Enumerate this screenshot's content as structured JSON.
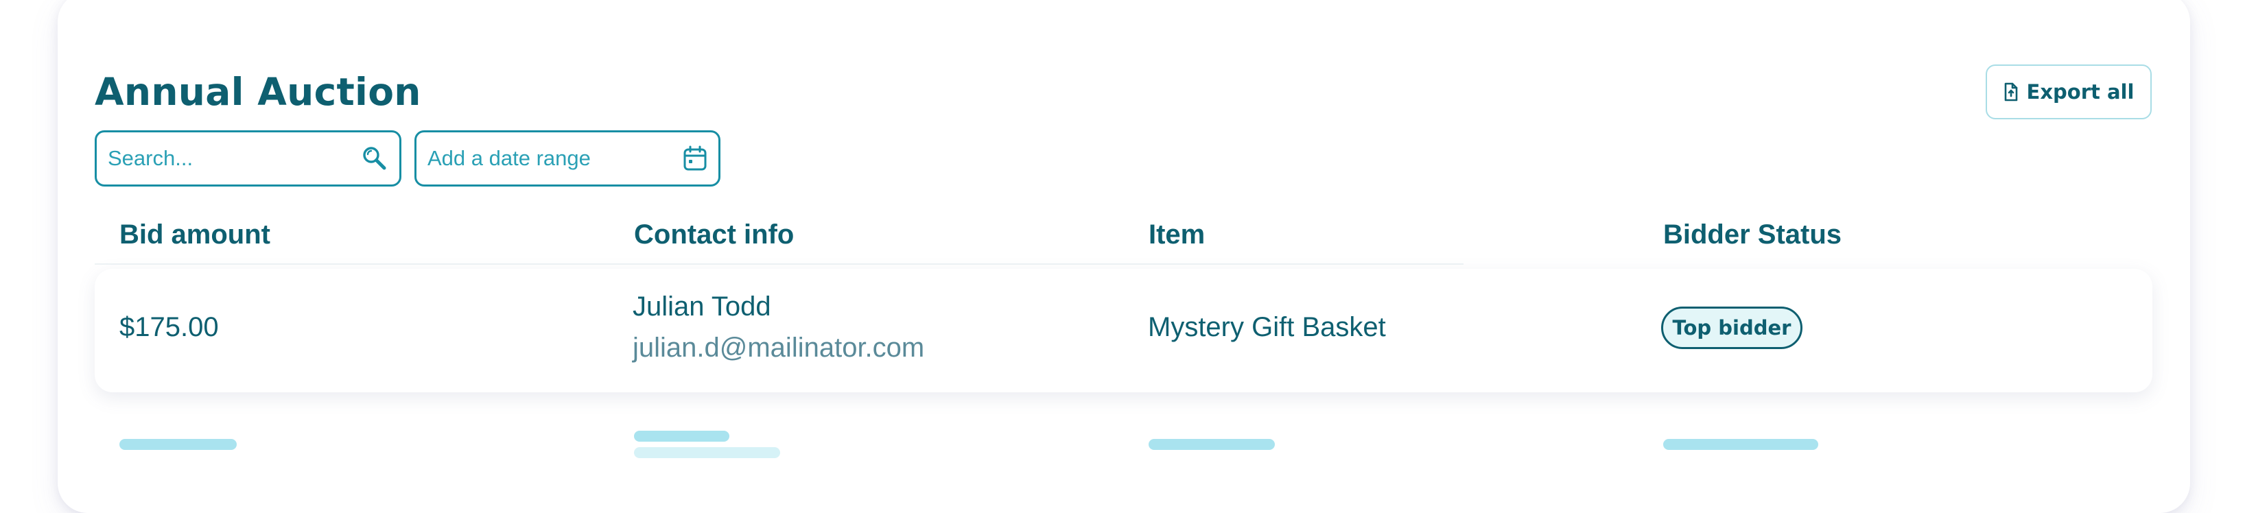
{
  "header": {
    "title": "Annual Auction",
    "export_label": "Export all"
  },
  "filters": {
    "search_placeholder": "Search...",
    "date_placeholder": "Add a date range"
  },
  "table": {
    "columns": [
      "Bid amount",
      "Contact info",
      "Item",
      "Bidder Status"
    ],
    "rows": [
      {
        "bid_amount": "$175.00",
        "contact_name": "Julian Todd",
        "contact_email": "julian.d@mailinator.com",
        "item": "Mystery Gift Basket",
        "status": "Top bidder"
      }
    ],
    "loading_placeholder_rows": 1
  },
  "icons": {
    "export": "file-export-icon",
    "search": "search-icon",
    "date": "calendar-icon"
  },
  "colors": {
    "primary_text": "#0e5f70",
    "accent": "#178ea4",
    "badge_background": "#e3f6f8",
    "skeleton": "#a9e3ef"
  }
}
